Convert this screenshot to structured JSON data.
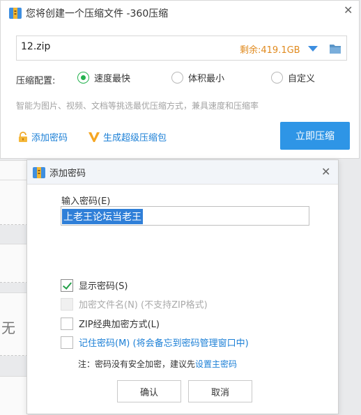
{
  "main_dialog": {
    "title": "您将创建一个压缩文件 -360压缩",
    "path_value": "12.zip",
    "remaining": "剩余:419.1GB",
    "config_label": "压缩配置:",
    "options": [
      {
        "label": "速度最快",
        "selected": true
      },
      {
        "label": "体积最小",
        "selected": false
      },
      {
        "label": "自定义",
        "selected": false
      }
    ],
    "hint": "智能为图片、视频、文档等挑选最优压缩方式，兼具速度和压缩率",
    "add_password": "添加密码",
    "super_pkg": "生成超级压缩包",
    "compress_button": "立即压缩"
  },
  "password_dialog": {
    "title": "添加密码",
    "input_label": "输入密码(E)",
    "password_value": "上老王论坛当老王",
    "checkboxes": [
      {
        "label": "显示密码(S)",
        "checked": true,
        "disabled": false
      },
      {
        "label": "加密文件名(N) (不支持ZIP格式)",
        "checked": false,
        "disabled": true
      },
      {
        "label": "ZIP经典加密方式(L)",
        "checked": false,
        "disabled": false
      },
      {
        "label": "记住密码(M) (将会备忘到密码管理窗口中)",
        "checked": false,
        "disabled": false
      }
    ],
    "note_prefix": "注：密码没有安全加密，建议先",
    "note_link": "设置主密码",
    "ok_button": "确认",
    "cancel_button": "取消"
  },
  "background": {
    "partial_text": "无"
  },
  "colors": {
    "accent_blue": "#2e95e6",
    "selected_green": "#24b24e",
    "remaining_orange": "#e08a1e",
    "link_blue": "#1b7fd6"
  },
  "icons": [
    "app-icon",
    "close-icon",
    "dropdown-icon",
    "folder-icon",
    "lock-icon",
    "v-badge-icon",
    "checkmark-icon"
  ]
}
